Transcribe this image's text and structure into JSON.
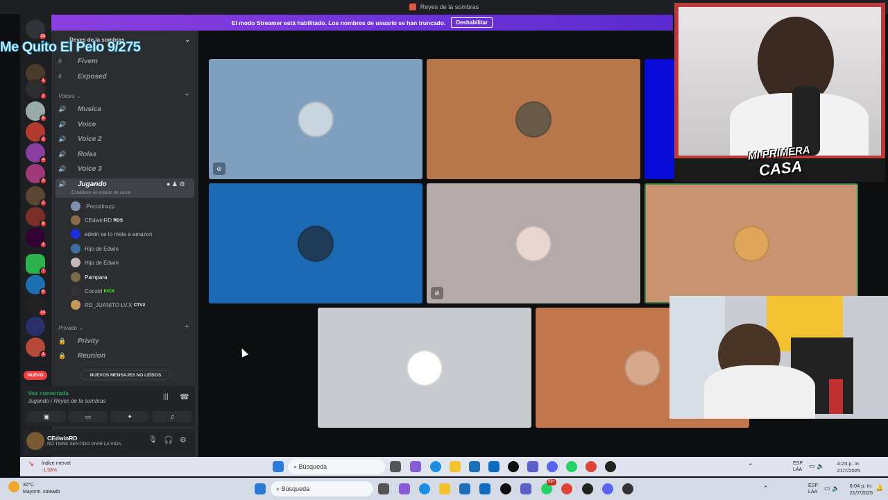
{
  "window": {
    "title": "Reyes de la sombras"
  },
  "streamer_bar": {
    "message": "El modo Streamer está habilitado. Los nombres de usuario se han truncado.",
    "button": "Deshabilitar"
  },
  "overlay": {
    "counter_text": "Me Quito El Pelo 9/275",
    "logo_line1": "MI PRIMERA",
    "logo_line2": "CASA"
  },
  "server": {
    "name": "Reyes de la sombras"
  },
  "rail_badges": [
    "26",
    "1",
    "2",
    "6",
    "2",
    "4",
    "3",
    "2",
    "6",
    "1",
    "7",
    "6",
    "14",
    "1"
  ],
  "channels_top": [
    {
      "name": "Fivem"
    },
    {
      "name": "Exposed"
    }
  ],
  "voices_category": "Voices",
  "voice_channels": [
    {
      "name": "Musica"
    },
    {
      "name": "Voice"
    },
    {
      "name": "Voice 2"
    },
    {
      "name": "Rolas"
    },
    {
      "name": "Voice 3"
    },
    {
      "name": "Jugando"
    }
  ],
  "active_channel_status": "Establece un estado de canal",
  "users": [
    {
      "name": ".Pocozinxzp",
      "tag": ""
    },
    {
      "name": "CEdwinRD",
      "tag": "RDS"
    },
    {
      "name": "edwin se lo mete a amazon",
      "tag": ""
    },
    {
      "name": "Hijo de Edwin",
      "tag": ""
    },
    {
      "name": "Hijo de Edwin",
      "tag": ""
    },
    {
      "name": "Pampara",
      "tag": ""
    },
    {
      "name": "Cocotrl",
      "tag": "KICK"
    },
    {
      "name": "RD_JUANITO LV.X",
      "tag": "CTV2"
    }
  ],
  "private_category": "Privado",
  "private_channels": [
    {
      "name": "Privity"
    },
    {
      "name": "Reunion"
    }
  ],
  "unread_pill": "NUEVOS MENSAJES NO LEÍDOS",
  "nuevo_badge": "NUEVO",
  "voice_panel": {
    "status": "Voz conectada",
    "location": "Jugando / Reyes de la sombras"
  },
  "user_panel": {
    "username": "CEdwinRD",
    "status": "NO TIENE SENTIDO VIVIR LA VIDA"
  },
  "tiles": [
    {
      "color": "#7f9fbf",
      "avatar": "#c8d4de"
    },
    {
      "color": "#b8764b",
      "avatar": "#6a5a48"
    },
    {
      "color": "#1c6ab3",
      "avatar": "#1f3b57"
    },
    {
      "color": "#b3aaa9",
      "avatar": "#e8d7d0"
    },
    {
      "color": "#c99371",
      "avatar": "#e0a45a"
    },
    {
      "color": "#c7cbcf",
      "avatar": "#fff"
    },
    {
      "color": "#c2764c",
      "avatar": "#d8a88a"
    }
  ],
  "taskbar_inner": {
    "weather_title": "Índice merval",
    "weather_value": "-1,58%",
    "search": "Búsqueda",
    "lang": "ESP",
    "lang2": "LAA",
    "time": "4:23 p. m.",
    "date": "21/7/2025"
  },
  "taskbar_outer": {
    "weather_temp": "30°C",
    "weather_desc": "Mayorm. soleado",
    "search": "Búsqueda",
    "lang": "ESP",
    "lang2": "LAA",
    "time": "6:04 p. m.",
    "date": "21/7/2025",
    "notif": "99+"
  }
}
